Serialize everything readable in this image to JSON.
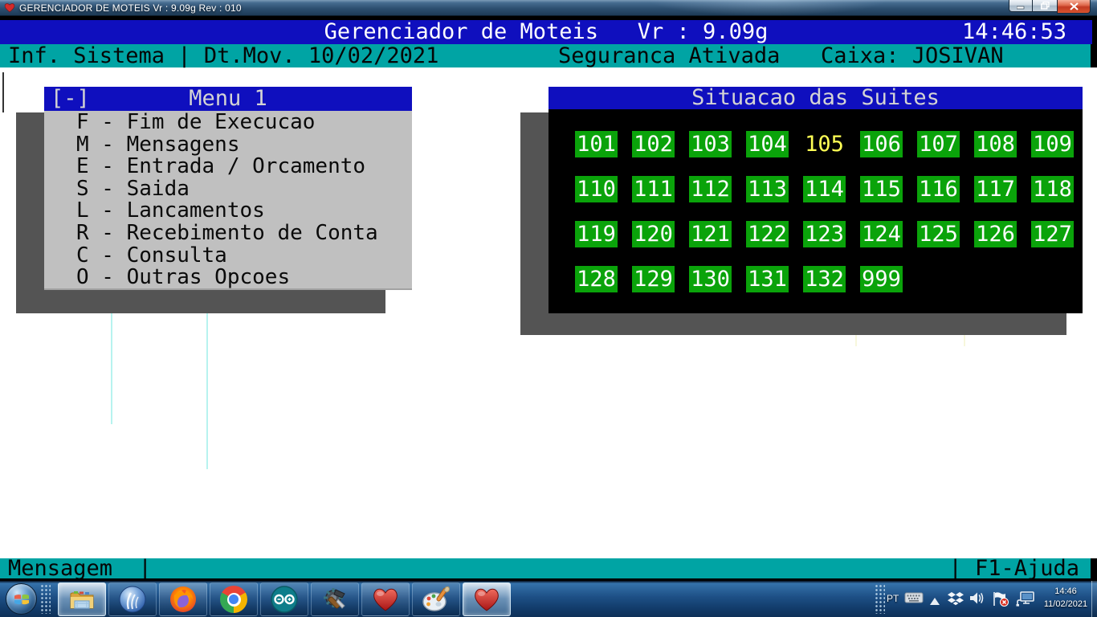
{
  "window": {
    "title": "GERENCIADOR DE MOTEIS  Vr : 9.09g  Rev : 010",
    "controls": {
      "minimize": "minimize",
      "restore": "restore",
      "close": "close"
    }
  },
  "app": {
    "colors": {
      "dos_blue": "#0f0fbe",
      "teal": "#00a4a4",
      "suite_green": "#0aa30a",
      "suite_selected_text": "#ffff55",
      "menu_bg": "#c0c0c0",
      "shadow_gray": "#545454"
    },
    "header": {
      "title": "Gerenciador de Moteis   Vr : 9.09g",
      "clock": "14:46:53"
    },
    "subheader": {
      "left": "Inf. Sistema | Dt.Mov. 10/02/2021",
      "security": "Seguranca Ativada",
      "cashier": "Caixa: JOSIVAN"
    },
    "menu": {
      "collapse": "[-]",
      "title": "Menu 1",
      "items": [
        "F - Fim de Execucao",
        "M - Mensagens",
        "E - Entrada / Orcamento",
        "S - Saida",
        "L - Lancamentos",
        "R - Recebimento de Conta",
        "C - Consulta",
        "O - Outras Opcoes"
      ]
    },
    "suites": {
      "title": "Situacao das Suites",
      "rows": [
        [
          {
            "n": "101",
            "state": "free"
          },
          {
            "n": "102",
            "state": "free"
          },
          {
            "n": "103",
            "state": "free"
          },
          {
            "n": "104",
            "state": "free"
          },
          {
            "n": "105",
            "state": "selected"
          },
          {
            "n": "106",
            "state": "free"
          },
          {
            "n": "107",
            "state": "free"
          },
          {
            "n": "108",
            "state": "free"
          },
          {
            "n": "109",
            "state": "free"
          }
        ],
        [
          {
            "n": "110",
            "state": "free"
          },
          {
            "n": "111",
            "state": "free"
          },
          {
            "n": "112",
            "state": "free"
          },
          {
            "n": "113",
            "state": "free"
          },
          {
            "n": "114",
            "state": "free"
          },
          {
            "n": "115",
            "state": "free"
          },
          {
            "n": "116",
            "state": "free"
          },
          {
            "n": "117",
            "state": "free"
          },
          {
            "n": "118",
            "state": "free"
          }
        ],
        [
          {
            "n": "119",
            "state": "free"
          },
          {
            "n": "120",
            "state": "free"
          },
          {
            "n": "121",
            "state": "free"
          },
          {
            "n": "122",
            "state": "free"
          },
          {
            "n": "123",
            "state": "free"
          },
          {
            "n": "124",
            "state": "free"
          },
          {
            "n": "125",
            "state": "free"
          },
          {
            "n": "126",
            "state": "free"
          },
          {
            "n": "127",
            "state": "free"
          }
        ],
        [
          {
            "n": "128",
            "state": "free"
          },
          {
            "n": "129",
            "state": "free"
          },
          {
            "n": "130",
            "state": "free"
          },
          {
            "n": "131",
            "state": "free"
          },
          {
            "n": "132",
            "state": "free"
          },
          {
            "n": "999",
            "state": "free"
          }
        ]
      ]
    },
    "statusbar": {
      "left": "Mensagem  |",
      "right": "| F1-Ajuda"
    }
  },
  "taskbar": {
    "start": "start-button",
    "buttons": [
      {
        "name": "windows-explorer",
        "active": true
      },
      {
        "name": "winbox",
        "active": false
      },
      {
        "name": "firefox",
        "active": false
      },
      {
        "name": "chrome",
        "active": false
      },
      {
        "name": "arduino",
        "active": false
      },
      {
        "name": "system-tools",
        "active": false
      },
      {
        "name": "moteis-app-heart",
        "active": false
      },
      {
        "name": "paint",
        "active": false
      },
      {
        "name": "moteis-app-heart-2",
        "active": true
      }
    ],
    "tray": {
      "lang": "PT",
      "icons": [
        "keyboard-icon",
        "show-hidden-arrow-icon",
        "dropbox-icon",
        "speaker-icon",
        "action-center-flag-icon",
        "network-icon"
      ],
      "time": "14:46",
      "date": "11/02/2021"
    }
  }
}
